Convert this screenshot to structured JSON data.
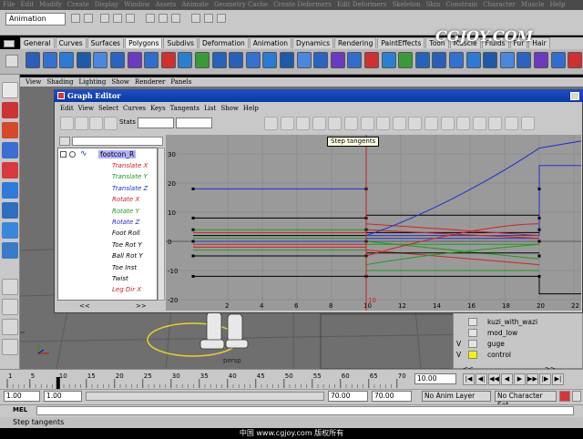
{
  "menubar": [
    "File",
    "Edit",
    "Modify",
    "Create",
    "Display",
    "Window",
    "Assets",
    "Animate",
    "Geometry Cache",
    "Create Deformers",
    "Edit Deformers",
    "Skeleton",
    "Skin",
    "Constrain",
    "Character",
    "Muscle",
    "Help"
  ],
  "status": {
    "mode": "Animation"
  },
  "shelf_tabs": [
    "General",
    "Curves",
    "Surfaces",
    "Polygons",
    "Subdivs",
    "Deformation",
    "Animation",
    "Dynamics",
    "Rendering",
    "PaintEffects",
    "Toon",
    "Muscle",
    "Fluids",
    "Fur",
    "Hair"
  ],
  "shelf_active": "Polygons",
  "panel_menu": [
    "View",
    "Shading",
    "Lighting",
    "Show",
    "Renderer",
    "Panels"
  ],
  "graph_editor": {
    "title": "Graph Editor",
    "menu": [
      "Edit",
      "View",
      "Select",
      "Curves",
      "Keys",
      "Tangents",
      "List",
      "Show",
      "Help"
    ],
    "stats_label": "Stats",
    "tooltip": "Step tangents",
    "node": "footcon_R",
    "channels": [
      {
        "name": "Translate X",
        "color": "#d42020"
      },
      {
        "name": "Translate Y",
        "color": "#18a018"
      },
      {
        "name": "Translate Z",
        "color": "#2030d0"
      },
      {
        "name": "Rotate X",
        "color": "#d42020"
      },
      {
        "name": "Rotate Y",
        "color": "#18a018"
      },
      {
        "name": "Rotate Z",
        "color": "#2030d0"
      },
      {
        "name": "Foot Roll",
        "color": "#000000"
      },
      {
        "name": "Toe Rot Y",
        "color": "#000000"
      },
      {
        "name": "Ball Rot Y",
        "color": "#000000"
      },
      {
        "name": "Toe Inst",
        "color": "#000000"
      },
      {
        "name": "Twist",
        "color": "#000000"
      },
      {
        "name": "Leg Dir X",
        "color": "#d42020"
      }
    ],
    "nav_left": "<<",
    "nav_right": ">>",
    "y_ticks": [
      "30",
      "20",
      "10",
      "0",
      "-10",
      "-20"
    ],
    "x_ticks": [
      "2",
      "4",
      "6",
      "8",
      "10",
      "12",
      "14",
      "16",
      "18",
      "20",
      "22"
    ],
    "key_label": "10"
  },
  "outliner": {
    "items": [
      {
        "vis": "",
        "label": "kuzi_with_wazi",
        "color": ""
      },
      {
        "vis": "",
        "label": "mod_low",
        "color": ""
      },
      {
        "vis": "V",
        "label": "guge",
        "color": ""
      },
      {
        "vis": "V",
        "label": "control",
        "color": "#f5f500"
      }
    ],
    "nav_left": "<<",
    "nav_right": ">>"
  },
  "timeline": {
    "ticks": [
      "1",
      "5",
      "10",
      "15",
      "20",
      "25",
      "30",
      "35",
      "40",
      "45",
      "50",
      "55",
      "60",
      "65",
      "70"
    ],
    "current_frame": "10.00"
  },
  "range": {
    "start": "1.00",
    "anim_start": "1.00",
    "anim_end": "70.00",
    "end": "70.00",
    "anim_layer": "No Anim Layer",
    "character_set": "No Character Set"
  },
  "command_line": {
    "label": "MEL"
  },
  "help_line": "Step tangents",
  "footer": "中国 www.cgjoy.com 版权所有",
  "viewport_label": "persp",
  "logo": "CGJOY.COM"
}
